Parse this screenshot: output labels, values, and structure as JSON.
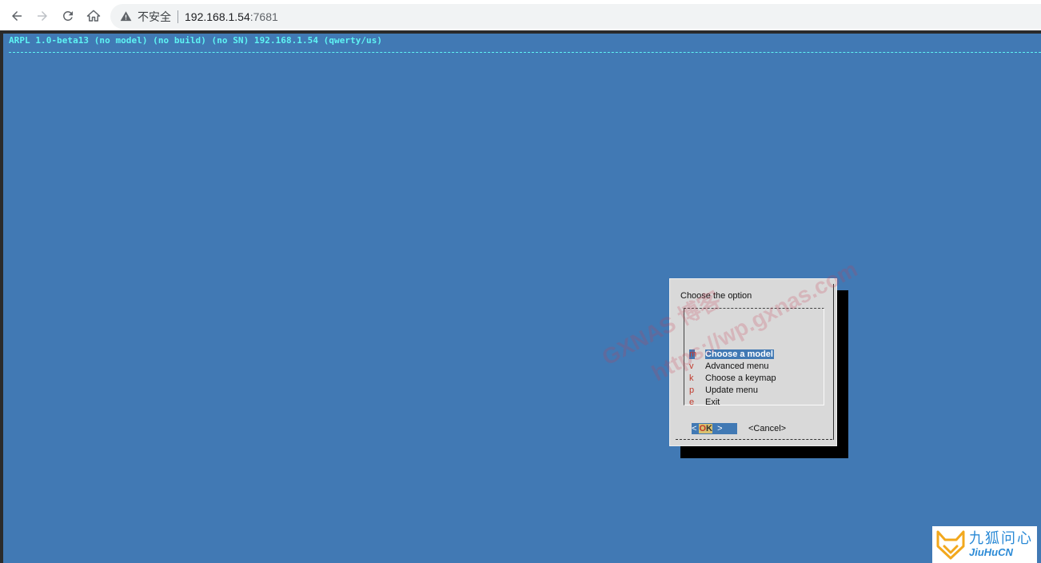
{
  "browser": {
    "security_label": "不安全",
    "url_host": "192.168.1.54",
    "url_port": ":7681"
  },
  "terminal": {
    "backtitle": "ARPL 1.0-beta13 (no model) (no build) (no SN) 192.168.1.54 (qwerty/us)",
    "background_color": "#4179b4",
    "accent_color": "#5ef4f4"
  },
  "dialog": {
    "title": "Choose the option",
    "items": [
      {
        "key": "m",
        "label": "Choose a model",
        "selected": true
      },
      {
        "key": "v",
        "label": "Advanced menu",
        "selected": false
      },
      {
        "key": "k",
        "label": "Choose a keymap",
        "selected": false
      },
      {
        "key": "p",
        "label": "Update menu",
        "selected": false
      },
      {
        "key": "e",
        "label": "Exit",
        "selected": false
      }
    ],
    "ok_open": "< ",
    "ok_hot": "O",
    "ok_rest": "K",
    "ok_close": "  >",
    "cancel_label": "<Cancel>"
  },
  "watermark": {
    "line1": "GXNAS 博客",
    "line2": "https://wp.gxnas.com"
  },
  "logo": {
    "cn": "九狐问心",
    "en": "JiuHuCN"
  }
}
